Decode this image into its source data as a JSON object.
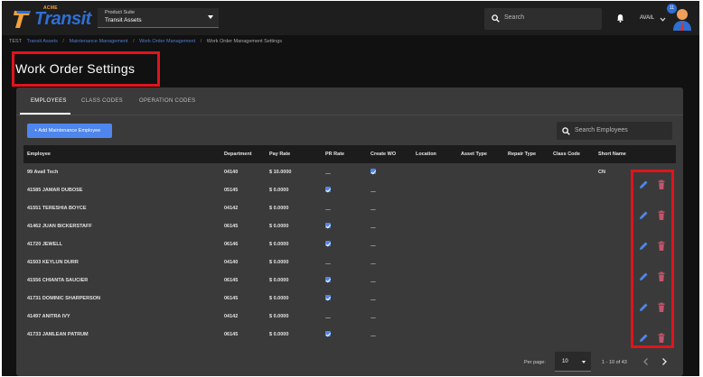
{
  "app": {
    "brand_small": "ACME",
    "brand": "Transit",
    "product_suite_label": "Product Suite",
    "product_suite_value": "Transit Assets",
    "search_placeholder": "Search",
    "user_name": "AVAIL",
    "notification_count": "11"
  },
  "breadcrumb": {
    "env": "TEST",
    "items": [
      "Transit Assets",
      "Maintenance Management",
      "Work Order Management"
    ],
    "current": "Work Order Management Settings",
    "separator": "/"
  },
  "page": {
    "title": "Work Order Settings"
  },
  "tabs": [
    {
      "label": "EMPLOYEES",
      "active": true
    },
    {
      "label": "CLASS CODES",
      "active": false
    },
    {
      "label": "OPERATION CODES",
      "active": false
    }
  ],
  "toolbar": {
    "add_label": "+ Add Maintenance Employee",
    "search_placeholder": "Search Employees"
  },
  "table": {
    "columns": [
      "Employee",
      "Department",
      "Pay Rate",
      "PR Rate",
      "Create WO",
      "Location",
      "Asset Type",
      "Repair Type",
      "Class Code",
      "Short Name"
    ],
    "rows": [
      {
        "employee": "99 Avail Tech",
        "department": "04140",
        "pay_rate": "$ 10.0000",
        "pr_rate": false,
        "create_wo": true,
        "short_name": "CN"
      },
      {
        "employee": "41585 JAMAR DUBOSE",
        "department": "05145",
        "pay_rate": "$ 0.0000",
        "pr_rate": true,
        "create_wo": false,
        "short_name": ""
      },
      {
        "employee": "41551 TERESHIA BOYCE",
        "department": "04142",
        "pay_rate": "$ 0.0000",
        "pr_rate": false,
        "create_wo": false,
        "short_name": ""
      },
      {
        "employee": "41462 JUAN BICKERSTAFF",
        "department": "06145",
        "pay_rate": "$ 0.0000",
        "pr_rate": true,
        "create_wo": false,
        "short_name": ""
      },
      {
        "employee": "41720 JEWELL",
        "department": "06146",
        "pay_rate": "$ 0.0000",
        "pr_rate": true,
        "create_wo": false,
        "short_name": ""
      },
      {
        "employee": "41503 KEYLUN DURR",
        "department": "04140",
        "pay_rate": "$ 0.0000",
        "pr_rate": false,
        "create_wo": false,
        "short_name": ""
      },
      {
        "employee": "41556 CHIANTA SAUCIER",
        "department": "06145",
        "pay_rate": "$ 0.0000",
        "pr_rate": true,
        "create_wo": false,
        "short_name": ""
      },
      {
        "employee": "41731 DOMINIC SHARPERSON",
        "department": "06145",
        "pay_rate": "$ 0.0000",
        "pr_rate": true,
        "create_wo": false,
        "short_name": ""
      },
      {
        "employee": "41497 ANITRA IVY",
        "department": "04142",
        "pay_rate": "$ 0.0000",
        "pr_rate": false,
        "create_wo": false,
        "short_name": ""
      },
      {
        "employee": "41733 JAMLEAN PATRUM",
        "department": "06145",
        "pay_rate": "$ 0.0000",
        "pr_rate": true,
        "create_wo": false,
        "short_name": ""
      }
    ],
    "action_icons": [
      "pencil-icon",
      "trash-icon"
    ]
  },
  "pagination": {
    "per_page_label": "Per page:",
    "per_page_value": "10",
    "range": "1 - 10 of 43"
  },
  "colors": {
    "accent": "#4f86ee",
    "highlight": "#e0141c",
    "delete": "#c2546c",
    "background": "#111111",
    "panel": "#3a3a3a"
  }
}
